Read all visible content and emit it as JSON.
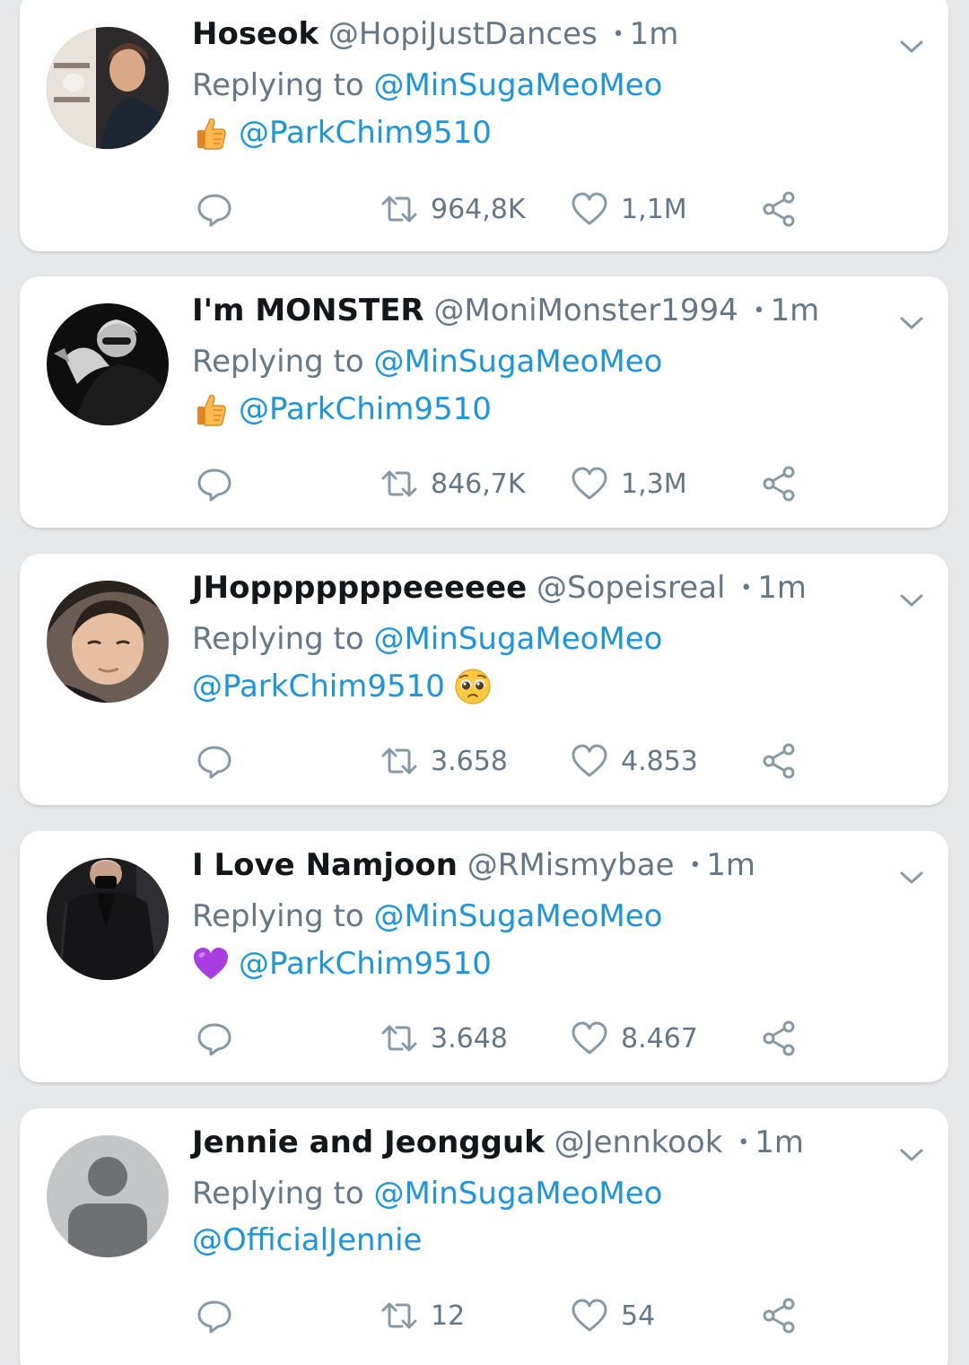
{
  "colors": {
    "background": "#e7e8ea",
    "card": "#ffffff",
    "link": "#1b95e0",
    "muted": "#657786",
    "name": "#14171a"
  },
  "tweets": [
    {
      "name": "Hoseok",
      "handle": "@HopiJustDances",
      "separator": "•",
      "time": "1m",
      "replying_prefix": "Replying to",
      "replying_to": "@MinSugaMeoMeo",
      "emoji_before": "thumbs-up-emoji",
      "mention": "@ParkChim9510",
      "emoji_after": "",
      "retweets": "964,8K",
      "likes": "1,1M",
      "avatar": "photo-avatar-brown"
    },
    {
      "name": "I'm MONSTER",
      "handle": "@MoniMonster1994",
      "separator": "•",
      "time": "1m",
      "replying_prefix": "Replying to",
      "replying_to": "@MinSugaMeoMeo",
      "emoji_before": "thumbs-up-emoji",
      "mention": "@ParkChim9510",
      "emoji_after": "",
      "retweets": "846,7K",
      "likes": "1,3M",
      "avatar": "photo-avatar-dark"
    },
    {
      "name": "JHopppppppeeeeee",
      "handle": "@Sopeisreal",
      "separator": "•",
      "time": "1m",
      "replying_prefix": "Replying to",
      "replying_to": "@MinSugaMeoMeo",
      "emoji_before": "",
      "mention": "@ParkChim9510",
      "emoji_after": "pleading-face-emoji",
      "retweets": "3.658",
      "likes": "4.853",
      "avatar": "photo-avatar-face"
    },
    {
      "name": "I Love Namjoon",
      "handle": "@RMismybae",
      "separator": "•",
      "time": "1m",
      "replying_prefix": "Replying to",
      "replying_to": "@MinSugaMeoMeo",
      "emoji_before": "purple-heart-emoji",
      "mention": "@ParkChim9510",
      "emoji_after": "",
      "retweets": "3.648",
      "likes": "8.467",
      "avatar": "photo-avatar-coat"
    },
    {
      "name": "Jennie and Jeongguk",
      "handle": "@Jennkook",
      "separator": "•",
      "time": "1m",
      "replying_prefix": "Replying to",
      "replying_to": "@MinSugaMeoMeo",
      "emoji_before": "",
      "mention": "@OfficialJennie",
      "emoji_after": "",
      "retweets": "12",
      "likes": "54",
      "avatar": "default-avatar"
    }
  ]
}
